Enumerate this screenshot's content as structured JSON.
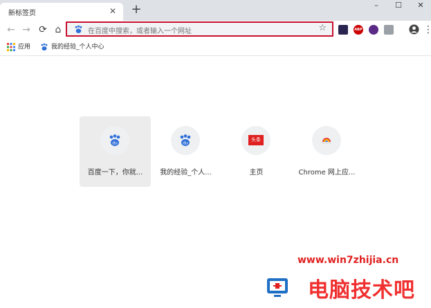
{
  "tab": {
    "title": "新标签页",
    "close_icon": "close-icon"
  },
  "window": {
    "minimize": "–",
    "maximize": "☐",
    "close": "✕"
  },
  "toolbar": {
    "back": "←",
    "forward": "→",
    "reload": "⟳",
    "home": "⌂"
  },
  "omnibox": {
    "placeholder": "在百度中搜索，或者输入一个网址",
    "highlight_color": "#c8102e"
  },
  "extensions": {
    "abp_label": "ABP"
  },
  "bookmarks": [
    {
      "label": "应用",
      "icon": "apps-grid-icon"
    },
    {
      "label": "我的经验_个人中心",
      "icon": "baidu-paw-icon"
    }
  ],
  "tiles": [
    {
      "label": "百度一下，你就...",
      "icon": "baidu-paw-icon"
    },
    {
      "label": "我的经验_个人...",
      "icon": "baidu-paw-icon"
    },
    {
      "label": "主页",
      "icon": "toutiao-icon",
      "badge": "头条"
    },
    {
      "label": "Chrome 网上应...",
      "icon": "chrome-webstore-icon"
    }
  ],
  "watermark": {
    "url": "www.win7zhijia.cn",
    "brand": "电脑技术吧"
  }
}
